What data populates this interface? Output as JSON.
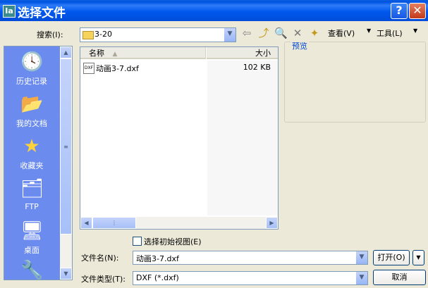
{
  "window": {
    "title": "选择文件",
    "app_icon": "Ia",
    "help_glyph": "?",
    "close_glyph": "✕"
  },
  "toolbar": {
    "search_label": "搜索(I):",
    "location": "3-20",
    "view_label": "查看(V)",
    "tools_label": "工具(L)",
    "icons": [
      "back-icon",
      "up-folder-icon",
      "search-web-icon",
      "delete-icon",
      "new-folder-icon"
    ]
  },
  "places": [
    {
      "label": "历史记录",
      "icon": "history-icon"
    },
    {
      "label": "我的文档",
      "icon": "my-documents-icon"
    },
    {
      "label": "收藏夹",
      "icon": "favorites-icon"
    },
    {
      "label": "FTP",
      "icon": "ftp-icon"
    },
    {
      "label": "桌面",
      "icon": "desktop-icon"
    }
  ],
  "file_list": {
    "columns": [
      "名称",
      "大小"
    ],
    "rows": [
      {
        "name": "动画3-7.dxf",
        "size": "102 KB",
        "type_badge": "DXF"
      }
    ]
  },
  "preview": {
    "label": "预览"
  },
  "checkbox": {
    "label": "选择初始视图(E)",
    "checked": false
  },
  "filename": {
    "label": "文件名(N):",
    "value": "动画3-7.dxf"
  },
  "filetype": {
    "label": "文件类型(T):",
    "value": "DXF (*.dxf)"
  },
  "buttons": {
    "open": "打开(O)",
    "cancel": "取消"
  },
  "colors": {
    "titlebar": "#0058EE",
    "places_bg": "#6C8BEE",
    "dialog_bg": "#ECE9D8"
  }
}
